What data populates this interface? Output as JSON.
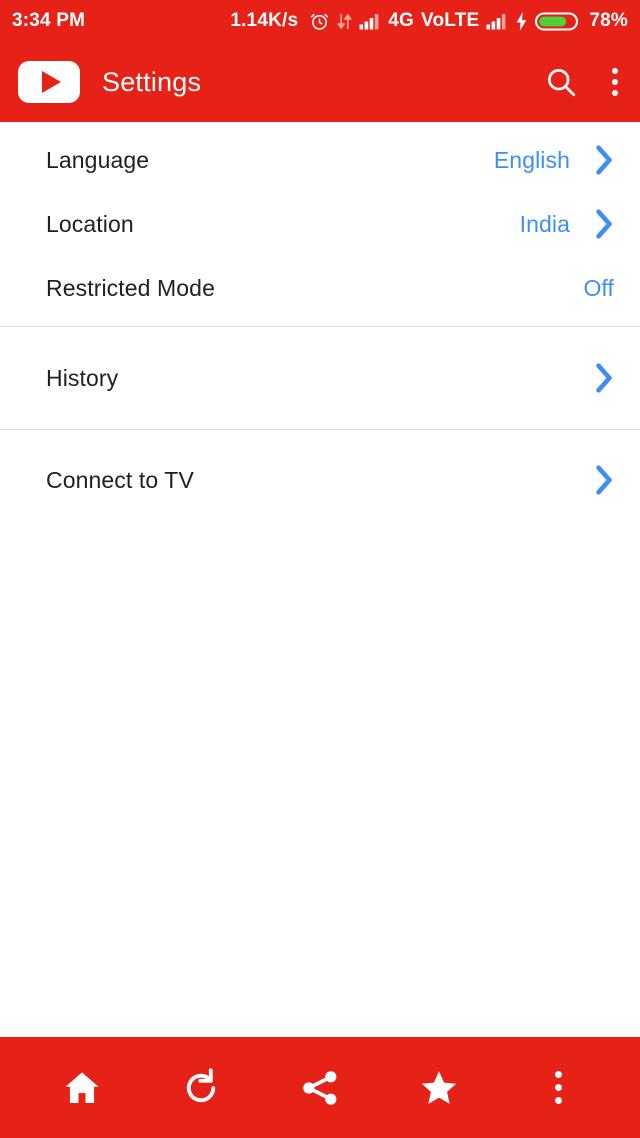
{
  "status_bar": {
    "time": "3:34 PM",
    "network_speed": "1.14K/s",
    "alarm_icon": "alarm-clock-icon",
    "data_transfer_icon": "data-transfer-icon",
    "signal_icon_1": "signal-bars-icon",
    "network_type": "4G",
    "volte_label": "VoLTE",
    "signal_icon_2": "signal-bars-icon",
    "charging_icon": "charging-bolt-icon",
    "battery_icon": "battery-icon",
    "battery_percent": "78%",
    "battery_level_color": "#4CD137",
    "background_color": "#E62117"
  },
  "app_bar": {
    "logo_icon": "youtube-logo-icon",
    "title": "Settings",
    "search_icon": "search-icon",
    "overflow_icon": "more-vertical-icon",
    "background_color": "#E62117"
  },
  "settings": {
    "groups": [
      {
        "rows": [
          {
            "label": "Language",
            "value": "English",
            "has_chevron": true
          },
          {
            "label": "Location",
            "value": "India",
            "has_chevron": true
          },
          {
            "label": "Restricted Mode",
            "value": "Off",
            "has_chevron": false
          }
        ]
      },
      {
        "rows": [
          {
            "label": "History",
            "value": "",
            "has_chevron": true
          }
        ]
      },
      {
        "rows": [
          {
            "label": "Connect to TV",
            "value": "",
            "has_chevron": true
          }
        ]
      }
    ],
    "accent_color": "#3D8EF5",
    "label_color": "#212121"
  },
  "bottom_bar": {
    "items": [
      {
        "icon": "home-icon",
        "name": "home"
      },
      {
        "icon": "refresh-icon",
        "name": "refresh"
      },
      {
        "icon": "share-icon",
        "name": "share"
      },
      {
        "icon": "star-icon",
        "name": "favorite"
      },
      {
        "icon": "more-vertical-icon",
        "name": "menu"
      }
    ],
    "background_color": "#E62117"
  }
}
